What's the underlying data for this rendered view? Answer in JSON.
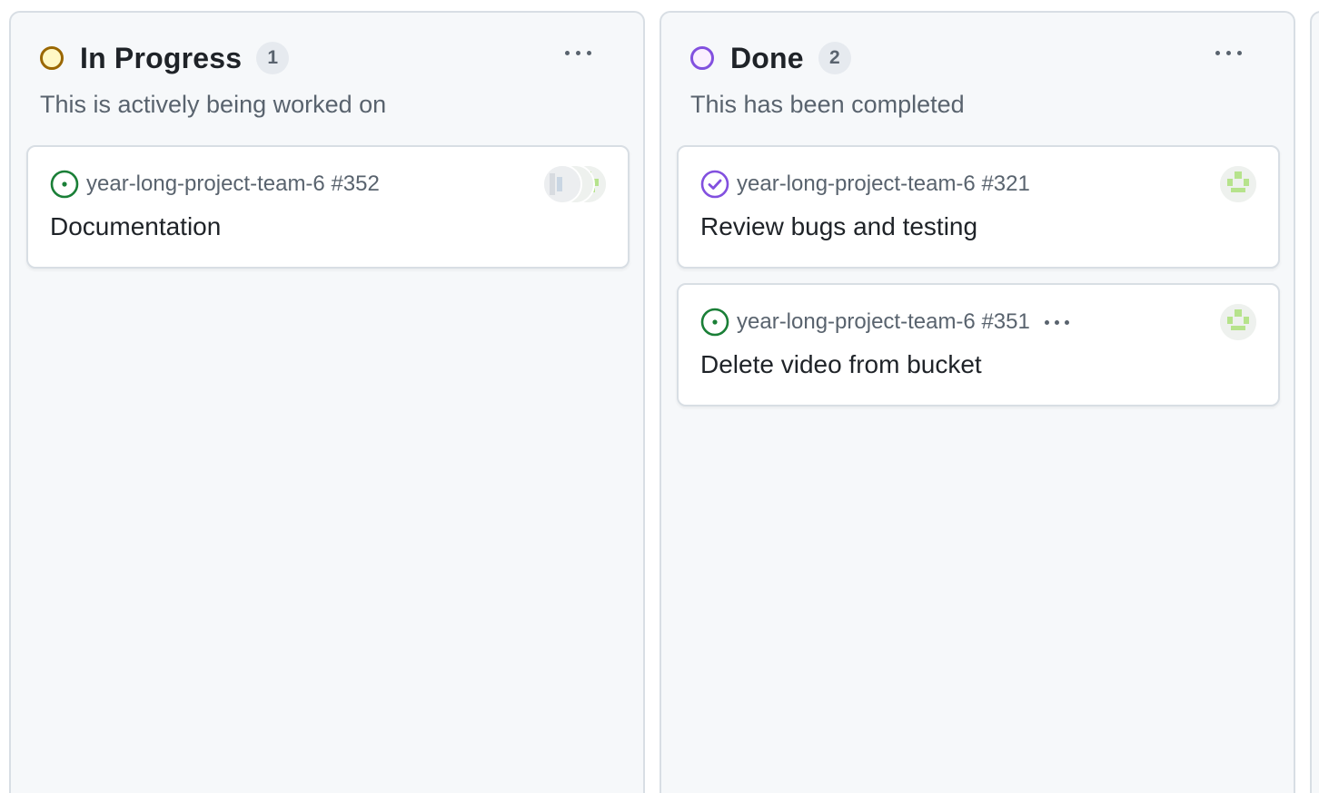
{
  "columns": [
    {
      "title": "In Progress",
      "count": "1",
      "description": "This is actively being worked on",
      "status_color": "#9a6700",
      "cards": [
        {
          "reference": "year-long-project-team-6 #352",
          "title": "Documentation",
          "state": "open",
          "avatars": [
            "identicon-green",
            "identicon-green",
            "identicon-gray"
          ]
        }
      ]
    },
    {
      "title": "Done",
      "count": "2",
      "description": "This has been completed",
      "status_color": "#8250df",
      "cards": [
        {
          "reference": "year-long-project-team-6 #321",
          "title": "Review bugs and testing",
          "state": "closed",
          "avatars": [
            "identicon-green"
          ]
        },
        {
          "reference": "year-long-project-team-6 #351",
          "title": "Delete video from bucket",
          "state": "open",
          "avatars": [
            "identicon-green"
          ]
        }
      ]
    }
  ],
  "colors": {
    "open_issue": "#1a7f37",
    "closed_issue": "#8250df",
    "identicon": "#b6e38c"
  }
}
